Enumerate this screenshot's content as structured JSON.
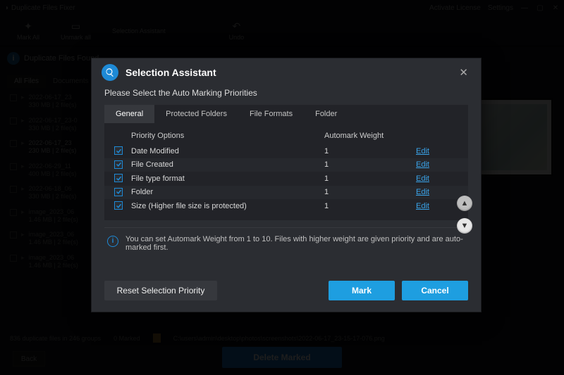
{
  "app": {
    "title": "Duplicate Files Fixer",
    "topRight": {
      "license": "Activate License",
      "settings": "Settings"
    }
  },
  "toolbar": {
    "markall": "Mark All",
    "unmarkall": "Unmark all",
    "assistant": "Selection Assistant",
    "undo": "Undo"
  },
  "banner": {
    "text": "Duplicate Files Found"
  },
  "pageTabs": {
    "all": "All Files",
    "docs": "Documents"
  },
  "files": [
    {
      "name": "2022-06-17_23",
      "meta": "330 MB | 2 file(s)"
    },
    {
      "name": "2022-06-17_23-0",
      "meta": "330 MB | 2 file(s)"
    },
    {
      "name": "2022-06-17_23",
      "meta": "230 MB | 2 file(s)"
    },
    {
      "name": "2022-06-29_11",
      "meta": "400 MB | 2 file(s)"
    },
    {
      "name": "2022-06-18_06",
      "meta": "330 MB | 2 file(s)"
    },
    {
      "name": "image_2023_06",
      "meta": "1.46 MB | 2 file(s)"
    },
    {
      "name": "image_2023_06",
      "meta": "1.46 MB | 2 file(s)"
    },
    {
      "name": "image_2023_06",
      "meta": "1.46 MB | 2 file(s)"
    }
  ],
  "footer": {
    "summary": "836 duplicate files in 246 groups",
    "marked": "0 Marked",
    "path": "C:\\users\\admin\\desktop\\photos\\screenshots\\2022-06-17_23-15-17-076.png",
    "back": "Back",
    "delete": "Delete Marked"
  },
  "modal": {
    "title": "Selection Assistant",
    "subtitle": "Please Select the Auto Marking Priorities",
    "tabs": [
      "General",
      "Protected Folders",
      "File Formats",
      "Folder"
    ],
    "activeTab": 0,
    "columns": {
      "priority": "Priority Options",
      "weight": "Automark Weight"
    },
    "rows": [
      {
        "label": "Date Modified",
        "weight": "1",
        "edit": "Edit"
      },
      {
        "label": "File Created",
        "weight": "1",
        "edit": "Edit"
      },
      {
        "label": "File type format",
        "weight": "1",
        "edit": "Edit"
      },
      {
        "label": "Folder",
        "weight": "1",
        "edit": "Edit"
      },
      {
        "label": "Size (Higher file size is protected)",
        "weight": "1",
        "edit": "Edit"
      }
    ],
    "note": "You can set Automark Weight from 1 to 10. Files with higher weight are given priority and are auto-marked first.",
    "buttons": {
      "reset": "Reset Selection Priority",
      "mark": "Mark",
      "cancel": "Cancel"
    }
  }
}
